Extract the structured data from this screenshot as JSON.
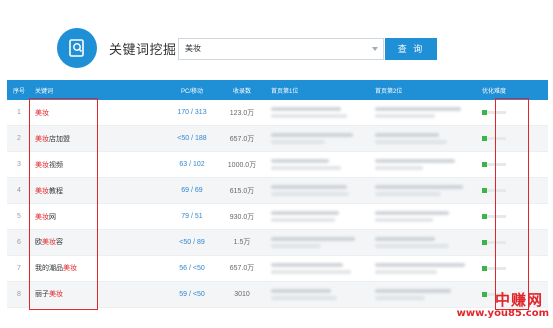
{
  "header": {
    "title": "关键词挖掘",
    "search_value": "美妆",
    "search_button": "查 询",
    "logo_icon": "magnifier-doc-icon"
  },
  "columns": [
    "序号",
    "关键词",
    "PC/移动",
    "收录数",
    "首页第1位",
    "首页第2位",
    "优化难度"
  ],
  "rows": [
    {
      "index": "1",
      "kw_pre": "",
      "kw_hl": "美妆",
      "kw_post": "",
      "pc": "170 / 313",
      "count": "123.0万",
      "difficulty": 0.2
    },
    {
      "index": "2",
      "kw_pre": "",
      "kw_hl": "美妆",
      "kw_post": "店加盟",
      "pc": "<50 / 188",
      "count": "657.0万",
      "difficulty": 0.2
    },
    {
      "index": "3",
      "kw_pre": "",
      "kw_hl": "美妆",
      "kw_post": "视频",
      "pc": "63 / 102",
      "count": "1000.0万",
      "difficulty": 0.2
    },
    {
      "index": "4",
      "kw_pre": "",
      "kw_hl": "美妆",
      "kw_post": "教程",
      "pc": "69 / 69",
      "count": "615.0万",
      "difficulty": 0.2
    },
    {
      "index": "5",
      "kw_pre": "",
      "kw_hl": "美妆",
      "kw_post": "网",
      "pc": "79 / 51",
      "count": "930.0万",
      "difficulty": 0.2
    },
    {
      "index": "6",
      "kw_pre": "欧",
      "kw_hl": "美妆",
      "kw_post": "容",
      "pc": "<50 / 89",
      "count": "1.5万",
      "difficulty": 0.2
    },
    {
      "index": "7",
      "kw_pre": "我的潮品",
      "kw_hl": "美妆",
      "kw_post": "",
      "pc": "56 / <50",
      "count": "657.0万",
      "difficulty": 0.2
    },
    {
      "index": "8",
      "kw_pre": "丽子",
      "kw_hl": "美妆",
      "kw_post": "",
      "pc": "59 / <50",
      "count": "3010",
      "difficulty": 0.2
    }
  ],
  "watermark": {
    "cn": "中赚网",
    "url": "www.you85.com"
  },
  "colors": {
    "accent": "#1f8fd6",
    "highlight": "#e0262a",
    "bar": "#3bb44a"
  }
}
